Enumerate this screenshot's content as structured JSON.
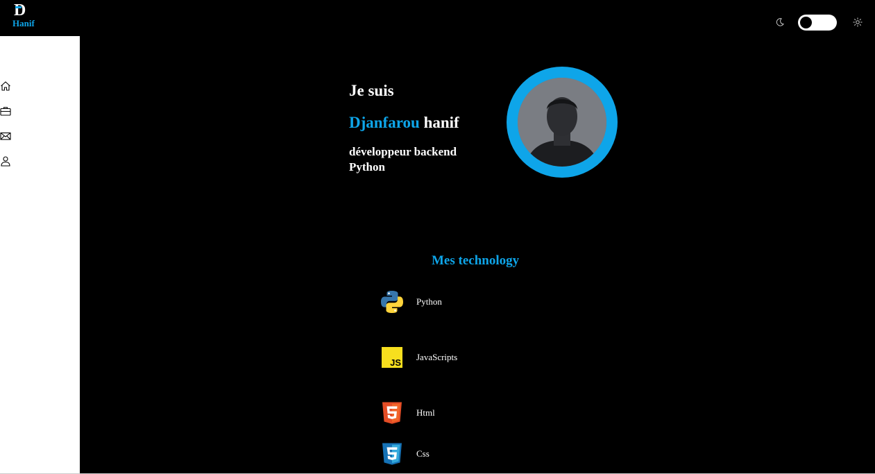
{
  "header": {
    "logo_letter": "D",
    "logo_text": "Hanif"
  },
  "sidebar": {
    "items": [
      {
        "icon": "home-icon"
      },
      {
        "icon": "briefcase-icon"
      },
      {
        "icon": "mail-icon"
      },
      {
        "icon": "user-icon"
      }
    ]
  },
  "hero": {
    "greeting": "Je suis",
    "first_name": "Djanfarou",
    "last_name": "hanif",
    "role": "développeur backend Python"
  },
  "technologies": {
    "title": "Mes technology",
    "items": [
      {
        "name": "Python",
        "icon": "python-logo-icon"
      },
      {
        "name": "JavaScripts",
        "icon": "javascript-logo-icon"
      },
      {
        "name": "Html",
        "icon": "html5-logo-icon"
      },
      {
        "name": "Css",
        "icon": "css3-logo-icon"
      }
    ]
  },
  "colors": {
    "accent": "#0ea5e9",
    "background": "#000000",
    "sidebar": "#ffffff"
  }
}
